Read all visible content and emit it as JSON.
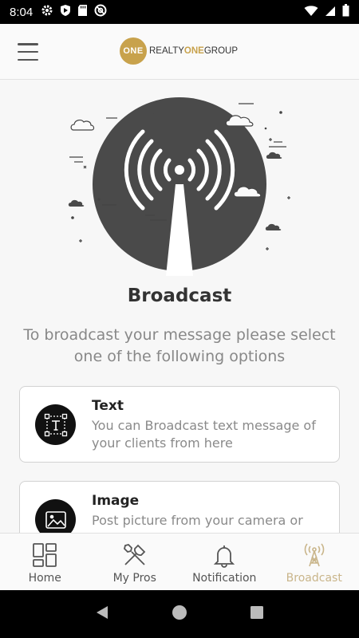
{
  "status": {
    "time": "8:04"
  },
  "header": {
    "logo_badge": "ONE",
    "logo_realty": "REALTY",
    "logo_one": "ONE",
    "logo_group": "GROUP"
  },
  "page": {
    "title": "Broadcast",
    "subtitle": "To broadcast your message please select one of the following options"
  },
  "options": [
    {
      "title": "Text",
      "description": "You can Broadcast text message of your clients from here",
      "icon": "text-box-icon"
    },
    {
      "title": "Image",
      "description": "Post picture from your camera or gallery",
      "icon": "image-icon"
    }
  ],
  "bottom_nav": {
    "items": [
      {
        "label": "Home",
        "icon": "home-grid-icon",
        "active": false
      },
      {
        "label": "My Pros",
        "icon": "tools-icon",
        "active": false
      },
      {
        "label": "Notification",
        "icon": "bell-icon",
        "active": false
      },
      {
        "label": "Broadcast",
        "icon": "broadcast-tower-icon",
        "active": true
      }
    ]
  },
  "colors": {
    "accent_gold": "#c8a24c",
    "inactive_nav": "#555555",
    "active_nav": "#c9b58a",
    "hero_circle": "#4a4a4a"
  }
}
